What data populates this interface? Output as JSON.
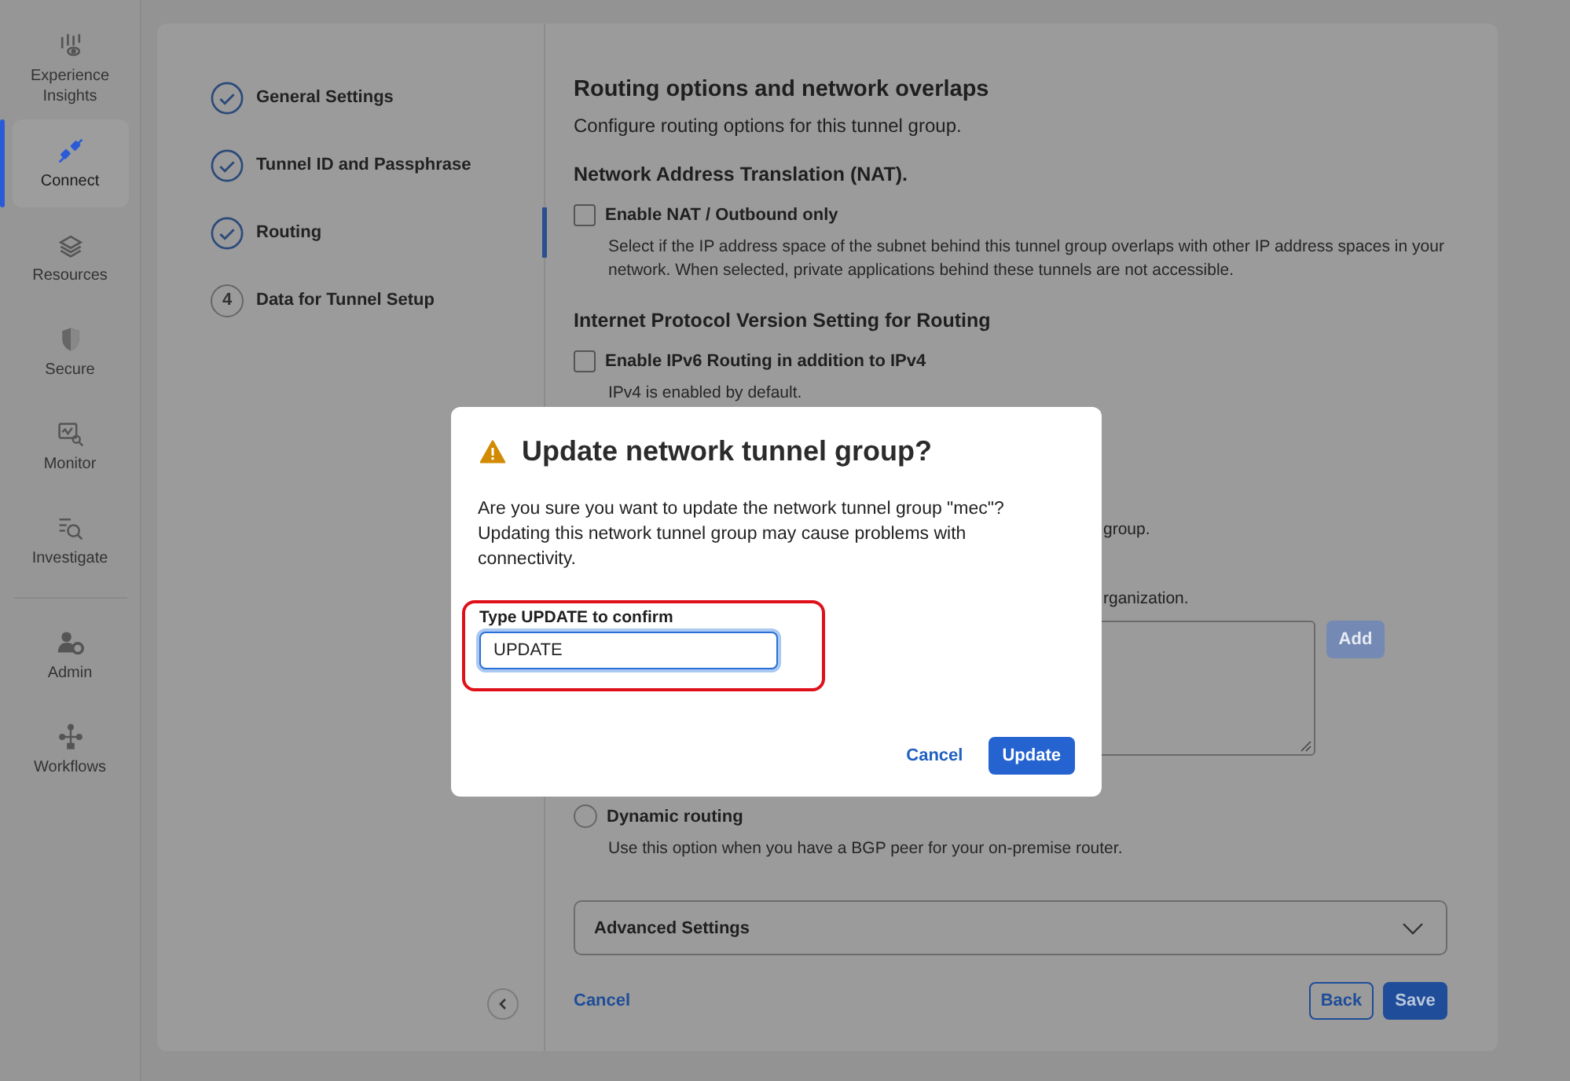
{
  "sidebar": {
    "items": [
      {
        "label": "Experience Insights",
        "selected": false
      },
      {
        "label": "Connect",
        "selected": true
      },
      {
        "label": "Resources",
        "selected": false
      },
      {
        "label": "Secure",
        "selected": false
      },
      {
        "label": "Monitor",
        "selected": false
      },
      {
        "label": "Investigate",
        "selected": false
      },
      {
        "label": "Admin",
        "selected": false,
        "divider_before": true
      },
      {
        "label": "Workflows",
        "selected": false
      }
    ]
  },
  "steps": [
    {
      "label": "General Settings",
      "kind": "done",
      "selected": false
    },
    {
      "label": "Tunnel ID and Passphrase",
      "kind": "done",
      "selected": false
    },
    {
      "label": "Routing",
      "kind": "done",
      "selected": true
    },
    {
      "label": "Data for Tunnel Setup",
      "kind": "number",
      "number": "4",
      "selected": false
    }
  ],
  "content": {
    "title": "Routing options and network overlaps",
    "subtitle": "Configure routing options for this tunnel group.",
    "nat": {
      "heading": "Network Address Translation (NAT).",
      "checkbox": {
        "label": "Enable NAT / Outbound only",
        "checked": false
      },
      "description": "Select if the IP address space of the subnet behind this tunnel group overlaps with other IP address spaces in your network. When selected, private applications behind these tunnels are not accessible."
    },
    "ip": {
      "heading": "Internet Protocol Version Setting for Routing",
      "checkbox": {
        "label": "Enable IPv6 Routing in addition to IPv4",
        "checked": false
      },
      "note": "IPv4 is enabled by default."
    },
    "partial_texts": [
      "group.",
      "rganization."
    ],
    "add_button": {
      "label": "Add",
      "disabled": true
    },
    "dynamic": {
      "label": "Dynamic routing",
      "selected": false,
      "description": "Use this option when you have a BGP peer for your on-premise router."
    },
    "advanced": {
      "label": "Advanced Settings",
      "expanded": false
    },
    "footer": {
      "cancel": "Cancel",
      "back": "Back",
      "save": "Save"
    }
  },
  "dialog": {
    "title": "Update network tunnel group?",
    "message": "Are you sure you want to update the network tunnel group \"mec\"? Updating this network tunnel group may cause problems with connectivity.",
    "field": {
      "label": "Type UPDATE to confirm",
      "value": "UPDATE"
    },
    "cancel": "Cancel",
    "confirm": "Update"
  }
}
